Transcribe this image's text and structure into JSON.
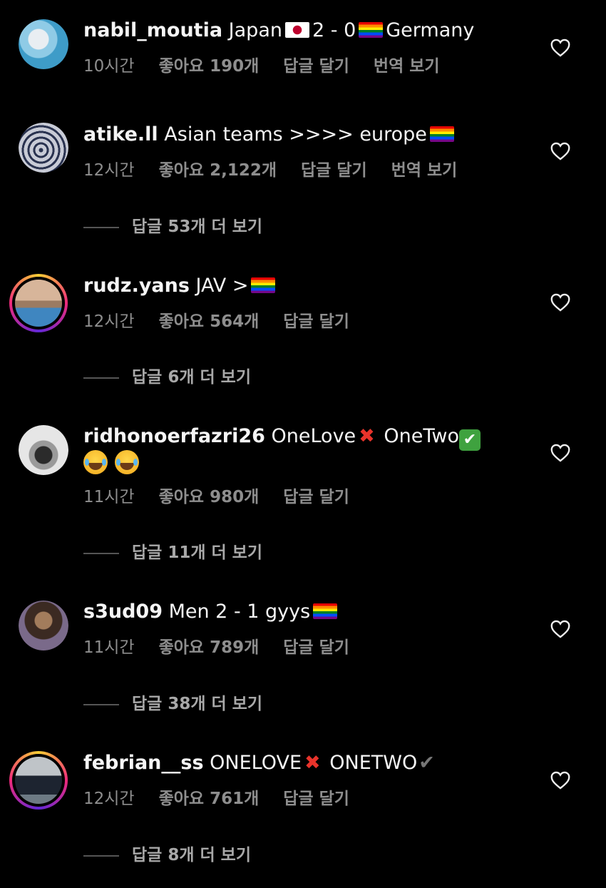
{
  "comments": [
    {
      "username": "nabil_moutia",
      "text_a": "Japan",
      "flag_a": "japan-flag",
      "text_b": "2 -  0",
      "flag_b": "rainbow-flag",
      "text_c": "Germany",
      "time": "10시간",
      "likes": "좋아요 190개",
      "reply": "답글 달기",
      "translate": "번역 보기",
      "avatar_colors": [
        "#6fb8d9",
        "#e9eef2"
      ]
    },
    {
      "username": "atike.ll",
      "text_a": "Asian teams >>>> europe",
      "flag_b": "rainbow-flag",
      "time": "12시간",
      "likes": "좋아요 2,122개",
      "reply": "답글 달기",
      "translate": "번역 보기",
      "view_replies": "답글 53개 더 보기",
      "avatar_colors": [
        "#c8cbd6",
        "#2a3350"
      ]
    },
    {
      "username": "rudz.yans",
      "text_a": "JAV >",
      "flag_b": "rainbow-flag",
      "time": "12시간",
      "likes": "좋아요 564개",
      "reply": "답글 달기",
      "view_replies": "답글 6개 더 보기",
      "avatar_colors": [
        "#c9a58c",
        "#2f6fa8"
      ]
    },
    {
      "username": "ridhonoerfazri26",
      "text_a": "OneLove",
      "text_b": "OneTwo",
      "time": "11시간",
      "likes": "좋아요 980개",
      "reply": "답글 달기",
      "view_replies": "답글 11개 더 보기",
      "avatar_colors": [
        "#d9d9d9",
        "#555555"
      ]
    },
    {
      "username": "s3ud09",
      "text_a": "Men 2 - 1 gyys",
      "flag_b": "rainbow-flag",
      "time": "11시간",
      "likes": "좋아요 789개",
      "reply": "답글 달기",
      "view_replies": "답글 38개 더 보기",
      "avatar_colors": [
        "#b08a6a",
        "#3b2a22"
      ]
    },
    {
      "username": "febrian__ss",
      "text_a": "ONELOVE",
      "text_b": "ONETWO",
      "time": "12시간",
      "likes": "좋아요 761개",
      "reply": "답글 달기",
      "view_replies": "답글 8개 더 보기",
      "avatar_colors": [
        "#c9c9c9",
        "#1d2430"
      ]
    }
  ],
  "icons": {
    "heart": "heart-outline-icon",
    "rainbow_flag": "rainbow-flag-icon",
    "japan_flag": "japan-flag-icon",
    "cross_mark": "cross-mark-icon",
    "check_box": "check-box-icon",
    "laugh": "tears-of-joy-icon"
  },
  "colors": {
    "background": "#000000",
    "text": "#f5f5f5",
    "meta": "#8e8e8e",
    "story_ring": "#ee2a7b"
  }
}
